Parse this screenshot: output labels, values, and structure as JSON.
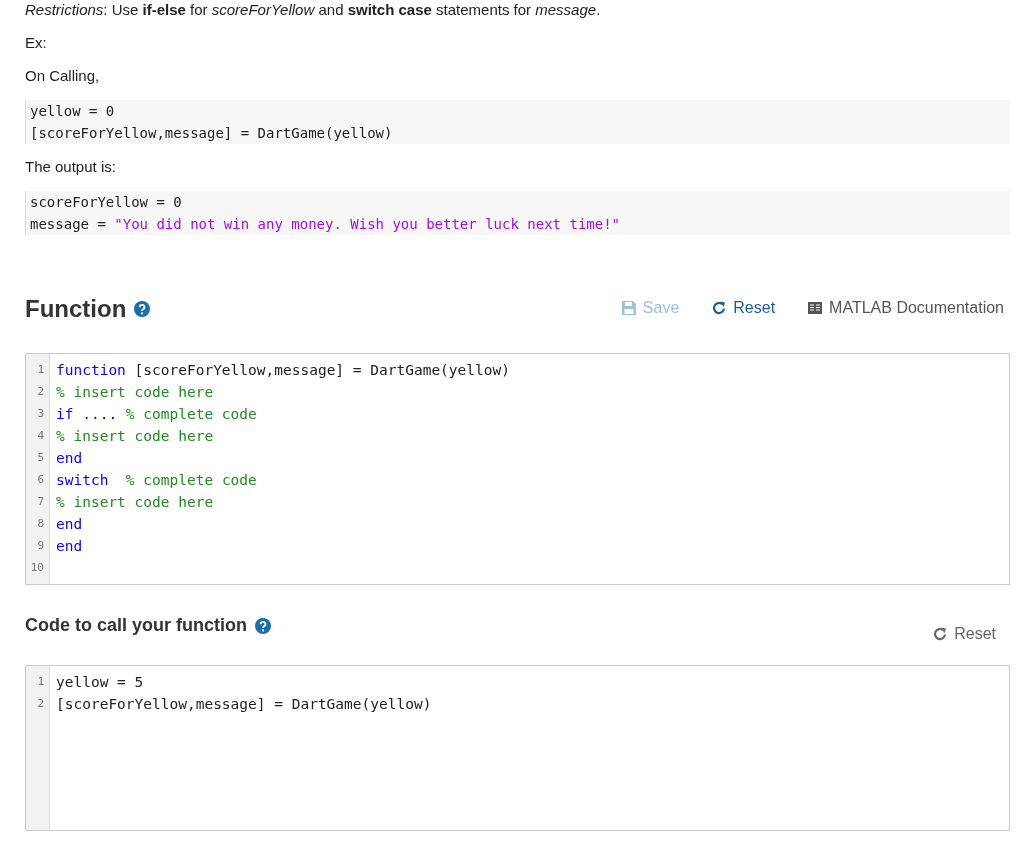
{
  "intro": [
    {
      "kind": "text",
      "text": "*Restrictions*: Use **if-else** for *scoreForYellow* and **switch case** statements for *message*."
    },
    {
      "kind": "text",
      "text": "Ex:"
    },
    {
      "kind": "text",
      "text": "On Calling,"
    },
    {
      "kind": "code",
      "lines": [
        [
          {
            "kind": "plain",
            "text": "yellow = 0"
          }
        ],
        [
          {
            "kind": "plain",
            "text": "[scoreForYellow,message] = DartGame(yellow)"
          }
        ]
      ]
    },
    {
      "kind": "text",
      "text": "The output is:"
    },
    {
      "kind": "code",
      "lines": [
        [
          {
            "kind": "plain",
            "text": "scoreForYellow = 0"
          }
        ],
        [
          {
            "kind": "plain",
            "text": "message = "
          },
          {
            "kind": "string",
            "text": "\"You did not win any money. Wish you better luck next time!\""
          }
        ]
      ]
    }
  ],
  "function_section": {
    "title": "Function",
    "actions": [
      {
        "kind": "save",
        "label": "Save",
        "disabled": true
      },
      {
        "kind": "reset",
        "label": "Reset",
        "disabled": false
      },
      {
        "kind": "docs",
        "label": "MATLAB Documentation",
        "disabled": false
      }
    ],
    "editor": {
      "lines": [
        {
          "number": "1",
          "tokens": [
            {
              "kind": "keyword",
              "text": "function"
            },
            {
              "kind": "plain",
              "text": " [scoreForYellow,message] = DartGame(yellow)"
            }
          ]
        },
        {
          "number": "2",
          "tokens": [
            {
              "kind": "comment",
              "text": "% insert code here"
            }
          ]
        },
        {
          "number": "3",
          "tokens": [
            {
              "kind": "keyword",
              "text": "if ...."
            },
            {
              "kind": "comment",
              "text": " % complete code"
            }
          ]
        },
        {
          "number": "4",
          "tokens": [
            {
              "kind": "comment",
              "text": "% insert code here"
            }
          ]
        },
        {
          "number": "5",
          "tokens": [
            {
              "kind": "keyword",
              "text": "end"
            }
          ]
        },
        {
          "number": "6",
          "tokens": [
            {
              "kind": "keyword",
              "text": "switch"
            },
            {
              "kind": "comment",
              "text": "  % complete code"
            }
          ]
        },
        {
          "number": "7",
          "tokens": [
            {
              "kind": "comment",
              "text": "% insert code here"
            }
          ]
        },
        {
          "number": "8",
          "tokens": [
            {
              "kind": "keyword",
              "text": "end"
            }
          ]
        },
        {
          "number": "9",
          "tokens": [
            {
              "kind": "keyword",
              "text": "end"
            }
          ]
        },
        {
          "number": "10"
        }
      ]
    }
  },
  "call_section": {
    "title": "Code to call your function",
    "actions": [
      {
        "kind": "reset",
        "label": "Reset",
        "disabled": false
      }
    ],
    "editor": {
      "lines": [
        {
          "number": "1",
          "tokens": [
            {
              "kind": "plain",
              "text": "yellow = 5"
            }
          ]
        },
        {
          "number": "2",
          "tokens": [
            {
              "kind": "plain",
              "text": "[scoreForYellow,message] = DartGame(yellow)"
            }
          ]
        }
      ]
    }
  }
}
